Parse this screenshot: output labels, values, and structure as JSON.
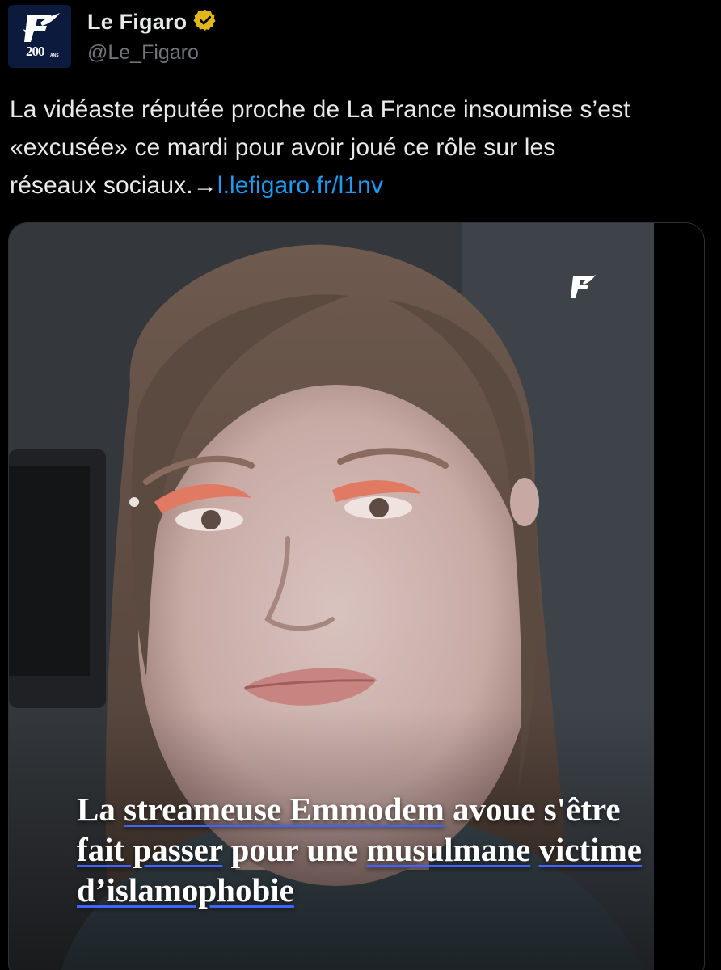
{
  "author": {
    "display_name": "Le Figaro",
    "handle": "@Le_Figaro",
    "avatar_text": "200",
    "avatar_subtext": "ANS",
    "verified_badge_color": "#e2b719"
  },
  "tweet": {
    "text_line1": "La vidéaste réputée proche de La France insoumise s’est",
    "text_line2": "«excusée» ce mardi pour avoir joué ce rôle sur les",
    "text_line3_prefix": "réseaux sociaux.→",
    "link_text": "l.lefigaro.fr/l1nv"
  },
  "media": {
    "headline_parts": [
      {
        "text": "La ",
        "underline": false
      },
      {
        "text": "streameuse Emmodem",
        "underline": true
      },
      {
        "text": " avoue s'être ",
        "underline": false
      },
      {
        "text": "fait passer",
        "underline": true
      },
      {
        "text": " pour une ",
        "underline": false
      },
      {
        "text": "musulmane",
        "underline": true
      },
      {
        "text": " ",
        "underline": false
      },
      {
        "text": "victime d’islamophobie",
        "underline": true
      }
    ],
    "logo_icon": "le-figaro-f-logo",
    "underline_color": "#3f63ff"
  },
  "colors": {
    "background": "#000000",
    "text": "#e7e9ea",
    "secondary_text": "#71767b",
    "link": "#1d9bf0",
    "avatar_bg": "#0c1a3d"
  }
}
